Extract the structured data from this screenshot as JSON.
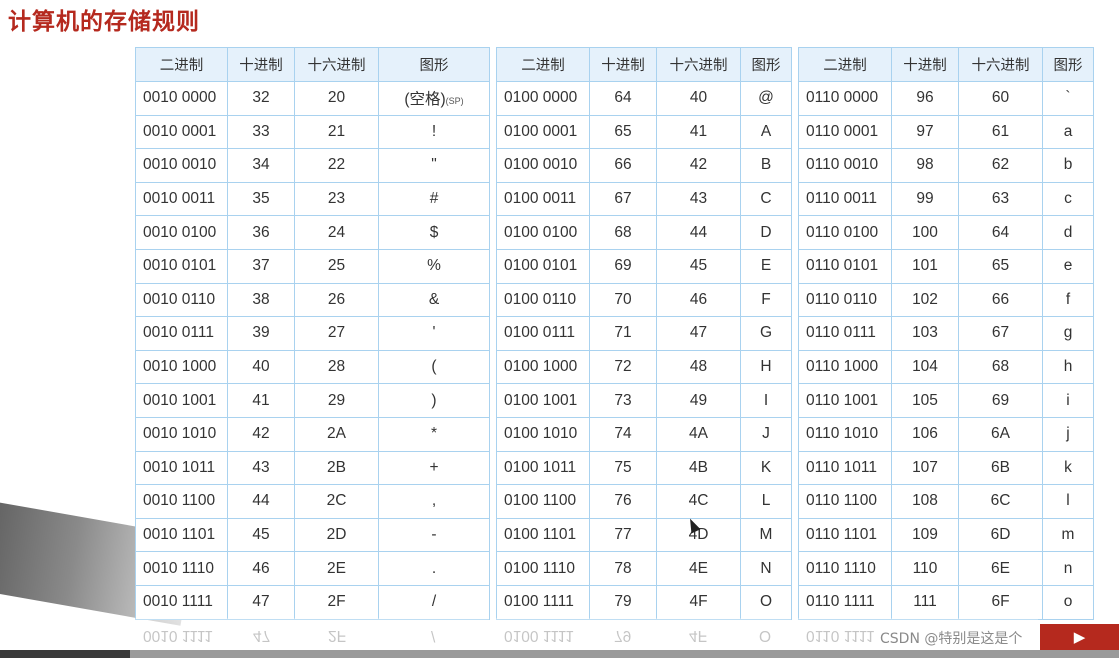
{
  "title": "计算机的存储规则",
  "headers": [
    "二进制",
    "十进制",
    "十六进制",
    "图形"
  ],
  "tables": [
    {
      "rows": [
        [
          "0010 0000",
          "32",
          "20",
          "(空格)",
          "(SP)"
        ],
        [
          "0010 0001",
          "33",
          "21",
          "!"
        ],
        [
          "0010 0010",
          "34",
          "22",
          "\""
        ],
        [
          "0010 0011",
          "35",
          "23",
          "#"
        ],
        [
          "0010 0100",
          "36",
          "24",
          "$"
        ],
        [
          "0010 0101",
          "37",
          "25",
          "%"
        ],
        [
          "0010 0110",
          "38",
          "26",
          "&"
        ],
        [
          "0010 0111",
          "39",
          "27",
          "'"
        ],
        [
          "0010 1000",
          "40",
          "28",
          "("
        ],
        [
          "0010 1001",
          "41",
          "29",
          ")"
        ],
        [
          "0010 1010",
          "42",
          "2A",
          "*"
        ],
        [
          "0010 1011",
          "43",
          "2B",
          "+"
        ],
        [
          "0010 1100",
          "44",
          "2C",
          ","
        ],
        [
          "0010 1101",
          "45",
          "2D",
          "-"
        ],
        [
          "0010 1110",
          "46",
          "2E",
          "."
        ],
        [
          "0010 1111",
          "47",
          "2F",
          "/"
        ]
      ]
    },
    {
      "rows": [
        [
          "0100 0000",
          "64",
          "40",
          "@"
        ],
        [
          "0100 0001",
          "65",
          "41",
          "A"
        ],
        [
          "0100 0010",
          "66",
          "42",
          "B"
        ],
        [
          "0100 0011",
          "67",
          "43",
          "C"
        ],
        [
          "0100 0100",
          "68",
          "44",
          "D"
        ],
        [
          "0100 0101",
          "69",
          "45",
          "E"
        ],
        [
          "0100 0110",
          "70",
          "46",
          "F"
        ],
        [
          "0100 0111",
          "71",
          "47",
          "G"
        ],
        [
          "0100 1000",
          "72",
          "48",
          "H"
        ],
        [
          "0100 1001",
          "73",
          "49",
          "I"
        ],
        [
          "0100 1010",
          "74",
          "4A",
          "J"
        ],
        [
          "0100 1011",
          "75",
          "4B",
          "K"
        ],
        [
          "0100 1100",
          "76",
          "4C",
          "L"
        ],
        [
          "0100 1101",
          "77",
          "4D",
          "M"
        ],
        [
          "0100 1110",
          "78",
          "4E",
          "N"
        ],
        [
          "0100 1111",
          "79",
          "4F",
          "O"
        ]
      ]
    },
    {
      "rows": [
        [
          "0110 0000",
          "96",
          "60",
          "`"
        ],
        [
          "0110 0001",
          "97",
          "61",
          "a"
        ],
        [
          "0110 0010",
          "98",
          "62",
          "b"
        ],
        [
          "0110 0011",
          "99",
          "63",
          "c"
        ],
        [
          "0110 0100",
          "100",
          "64",
          "d"
        ],
        [
          "0110 0101",
          "101",
          "65",
          "e"
        ],
        [
          "0110 0110",
          "102",
          "66",
          "f"
        ],
        [
          "0110 0111",
          "103",
          "67",
          "g"
        ],
        [
          "0110 1000",
          "104",
          "68",
          "h"
        ],
        [
          "0110 1001",
          "105",
          "69",
          "i"
        ],
        [
          "0110 1010",
          "106",
          "6A",
          "j"
        ],
        [
          "0110 1011",
          "107",
          "6B",
          "k"
        ],
        [
          "0110 1100",
          "108",
          "6C",
          "l"
        ],
        [
          "0110 1101",
          "109",
          "6D",
          "m"
        ],
        [
          "0110 1110",
          "110",
          "6E",
          "n"
        ],
        [
          "0110 1111",
          "111",
          "6F",
          "o"
        ]
      ]
    }
  ],
  "watermark": "CSDN @特别是这是个",
  "colors": {
    "title": "#b5291e",
    "header_bg": "#e5f1fb",
    "border": "#a9d2ef",
    "badge": "#b5291e"
  }
}
